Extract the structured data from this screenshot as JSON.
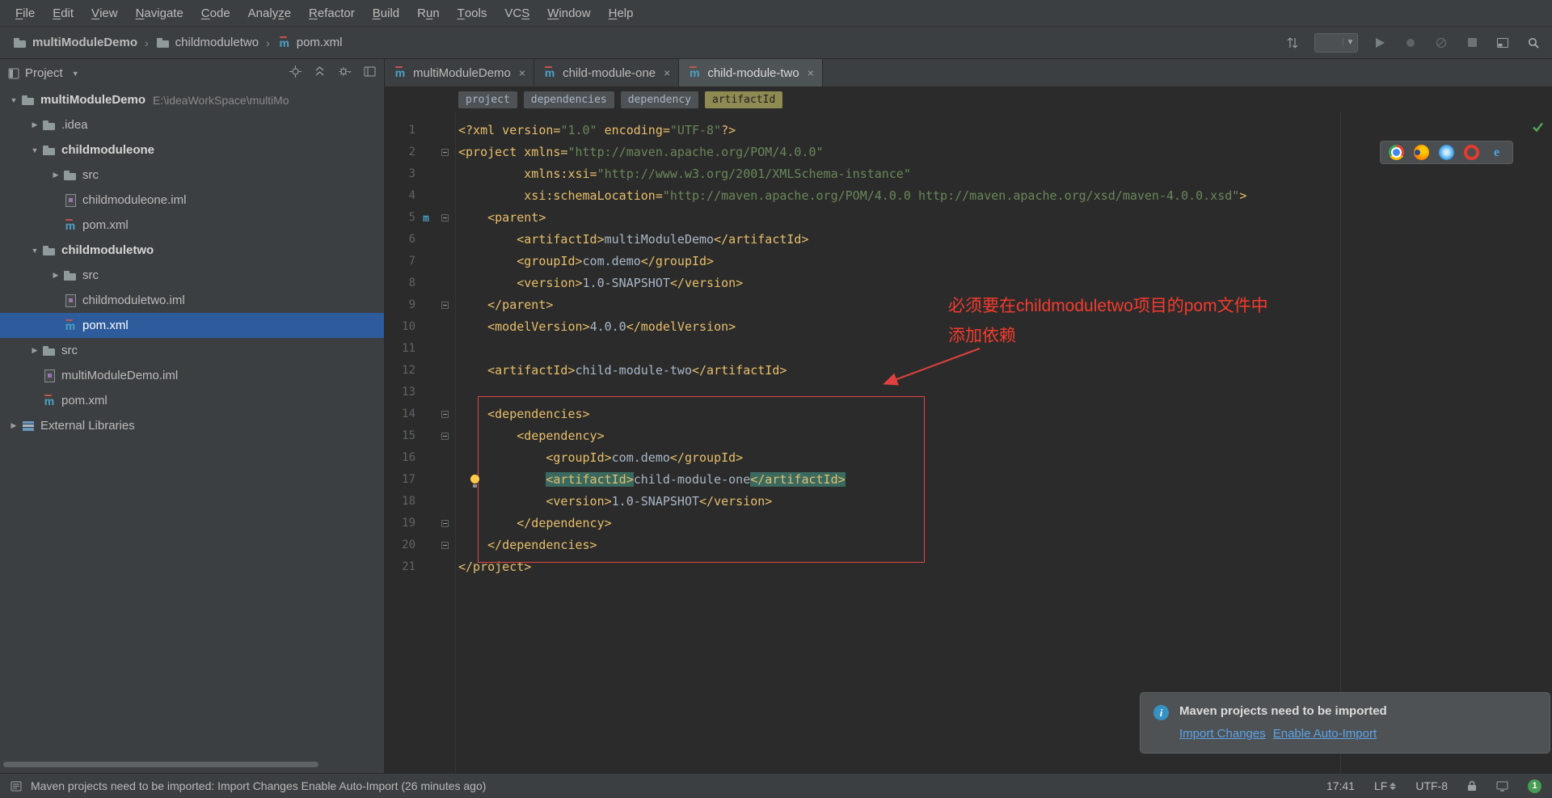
{
  "colors": {
    "panel_bg": "#3c3f41",
    "editor_bg": "#2b2b2b",
    "selection_blue": "#2d5b9b",
    "annotation_red": "#f43b2e",
    "xml_tag": "#e8bf6a",
    "xml_string": "#6a8759",
    "code_text": "#a9b7c6",
    "link_blue": "#5da3e8",
    "badge_green": "#499c54"
  },
  "menu_bar": {
    "items": [
      {
        "label": "File",
        "mi": 0
      },
      {
        "label": "Edit",
        "mi": 0
      },
      {
        "label": "View",
        "mi": 0
      },
      {
        "label": "Navigate",
        "mi": 0
      },
      {
        "label": "Code",
        "mi": 0
      },
      {
        "label": "Analyze",
        "mi": 5
      },
      {
        "label": "Refactor",
        "mi": 0
      },
      {
        "label": "Build",
        "mi": 0
      },
      {
        "label": "Run",
        "mi": 1
      },
      {
        "label": "Tools",
        "mi": 0
      },
      {
        "label": "VCS",
        "mi": 2
      },
      {
        "label": "Window",
        "mi": 0
      },
      {
        "label": "Help",
        "mi": 0
      }
    ]
  },
  "nav_bar": {
    "crumbs": [
      {
        "label": "multiModuleDemo",
        "icon": "folder"
      },
      {
        "label": "childmoduletwo",
        "icon": "folder"
      },
      {
        "label": "pom.xml",
        "icon": "maven"
      }
    ],
    "tool_icons": [
      "updates-icon",
      "run-config-combo",
      "run-icon",
      "profiler-icon",
      "coverage-icon",
      "stop-icon",
      "tool-windows-icon",
      "search-icon"
    ]
  },
  "project_panel": {
    "title": "Project",
    "header_icons": [
      "locate-file-icon",
      "collapse-all-icon",
      "settings-gear-icon",
      "hide-panel-icon"
    ],
    "tree": [
      {
        "label": "multiModuleDemo",
        "path": "E:\\ideaWorkSpace\\multiMo",
        "level": 0,
        "arrow": "expanded",
        "icon": "folder",
        "bold": true
      },
      {
        "label": ".idea",
        "level": 1,
        "arrow": "collapsed",
        "icon": "folder"
      },
      {
        "label": "childmoduleone",
        "level": 1,
        "arrow": "expanded",
        "icon": "folder",
        "bold": true
      },
      {
        "label": "src",
        "level": 2,
        "arrow": "collapsed",
        "icon": "folder"
      },
      {
        "label": "childmoduleone.iml",
        "level": 2,
        "icon": "iml"
      },
      {
        "label": "pom.xml",
        "level": 2,
        "icon": "maven"
      },
      {
        "label": "childmoduletwo",
        "level": 1,
        "arrow": "expanded",
        "icon": "folder",
        "bold": true
      },
      {
        "label": "src",
        "level": 2,
        "arrow": "collapsed",
        "icon": "folder"
      },
      {
        "label": "childmoduletwo.iml",
        "level": 2,
        "icon": "iml"
      },
      {
        "label": "pom.xml",
        "level": 2,
        "icon": "maven",
        "selected": true
      },
      {
        "label": "src",
        "level": 1,
        "arrow": "collapsed",
        "icon": "folder"
      },
      {
        "label": "multiModuleDemo.iml",
        "level": 1,
        "icon": "iml"
      },
      {
        "label": "pom.xml",
        "level": 1,
        "icon": "maven"
      },
      {
        "label": "External Libraries",
        "level": 0,
        "arrow": "collapsed",
        "icon": "library"
      }
    ]
  },
  "editor": {
    "tabs": [
      {
        "label": "multiModuleDemo"
      },
      {
        "label": "child-module-one"
      },
      {
        "label": "child-module-two",
        "active": true
      }
    ],
    "breadcrumbs": [
      {
        "label": "project"
      },
      {
        "label": "dependencies"
      },
      {
        "label": "dependency"
      },
      {
        "label": "artifactId",
        "active": true
      }
    ],
    "fold_marks": {
      "2": "start",
      "5": "start",
      "9": "end",
      "14": "start",
      "15": "start",
      "19": "end",
      "20": "end"
    },
    "gutter_icons": {
      "5": "maven-parent-icon"
    },
    "bulb_line": 17,
    "inspection_status_icon": "inspections-ok-check",
    "lines": [
      [
        [
          "tag",
          "<?xml version="
        ],
        [
          "str",
          "\"1.0\""
        ],
        [
          "tag",
          " encoding="
        ],
        [
          "str",
          "\"UTF-8\""
        ],
        [
          "tag",
          "?>"
        ]
      ],
      [
        [
          "tag",
          "<project xmlns="
        ],
        [
          "str",
          "\"http://maven.apache.org/POM/4.0.0\""
        ]
      ],
      [
        [
          "plain",
          "         "
        ],
        [
          "tag",
          "xmlns:xsi="
        ],
        [
          "str",
          "\"http://www.w3.org/2001/XMLSchema-instance\""
        ]
      ],
      [
        [
          "plain",
          "         "
        ],
        [
          "tag",
          "xsi:schemaLocation="
        ],
        [
          "str",
          "\"http://maven.apache.org/POM/4.0.0 http://maven.apache.org/xsd/maven-4.0.0.xsd\""
        ],
        [
          "tag",
          ">"
        ]
      ],
      [
        [
          "plain",
          "    "
        ],
        [
          "tag",
          "<parent>"
        ]
      ],
      [
        [
          "plain",
          "        "
        ],
        [
          "tag",
          "<artifactId>"
        ],
        [
          "txt",
          "multiModuleDemo"
        ],
        [
          "tag",
          "</artifactId>"
        ]
      ],
      [
        [
          "plain",
          "        "
        ],
        [
          "tag",
          "<groupId>"
        ],
        [
          "txt",
          "com.demo"
        ],
        [
          "tag",
          "</groupId>"
        ]
      ],
      [
        [
          "plain",
          "        "
        ],
        [
          "tag",
          "<version>"
        ],
        [
          "txt",
          "1.0-SNAPSHOT"
        ],
        [
          "tag",
          "</version>"
        ]
      ],
      [
        [
          "plain",
          "    "
        ],
        [
          "tag",
          "</parent>"
        ]
      ],
      [
        [
          "plain",
          "    "
        ],
        [
          "tag",
          "<modelVersion>"
        ],
        [
          "txt",
          "4.0.0"
        ],
        [
          "tag",
          "</modelVersion>"
        ]
      ],
      [],
      [
        [
          "plain",
          "    "
        ],
        [
          "tag",
          "<artifactId>"
        ],
        [
          "txt",
          "child-module-two"
        ],
        [
          "tag",
          "</artifactId>"
        ]
      ],
      [],
      [
        [
          "plain",
          "    "
        ],
        [
          "tag",
          "<dependencies>"
        ]
      ],
      [
        [
          "plain",
          "        "
        ],
        [
          "tag",
          "<dependency>"
        ]
      ],
      [
        [
          "plain",
          "            "
        ],
        [
          "tag",
          "<groupId>"
        ],
        [
          "txt",
          "com.demo"
        ],
        [
          "tag",
          "</groupId>"
        ]
      ],
      [
        [
          "plain",
          "            "
        ],
        [
          "taghl",
          "<artifactId>"
        ],
        [
          "txt",
          "child-module-one"
        ],
        [
          "taghl",
          "</artifactId>"
        ]
      ],
      [
        [
          "plain",
          "            "
        ],
        [
          "tag",
          "<version>"
        ],
        [
          "txt",
          "1.0-SNAPSHOT"
        ],
        [
          "tag",
          "</version>"
        ]
      ],
      [
        [
          "plain",
          "        "
        ],
        [
          "tag",
          "</dependency>"
        ]
      ],
      [
        [
          "plain",
          "    "
        ],
        [
          "tag",
          "</dependencies>"
        ]
      ],
      [
        [
          "tag",
          "</project>"
        ]
      ]
    ]
  },
  "annotation": {
    "line1": "必须要在childmoduletwo项目的pom文件中",
    "line2": "添加依赖"
  },
  "browser_toolbar": [
    "chrome-icon",
    "firefox-icon",
    "safari-icon",
    "opera-icon",
    "ie-icon"
  ],
  "notification": {
    "title": "Maven projects need to be imported",
    "links": [
      "Import Changes",
      "Enable Auto-Import"
    ]
  },
  "status_bar": {
    "message": "Maven projects need to be imported: Import Changes Enable Auto-Import (26 minutes ago)",
    "time": "17:41",
    "line_separator": "LF",
    "encoding": "UTF-8",
    "notification_count": "1"
  }
}
